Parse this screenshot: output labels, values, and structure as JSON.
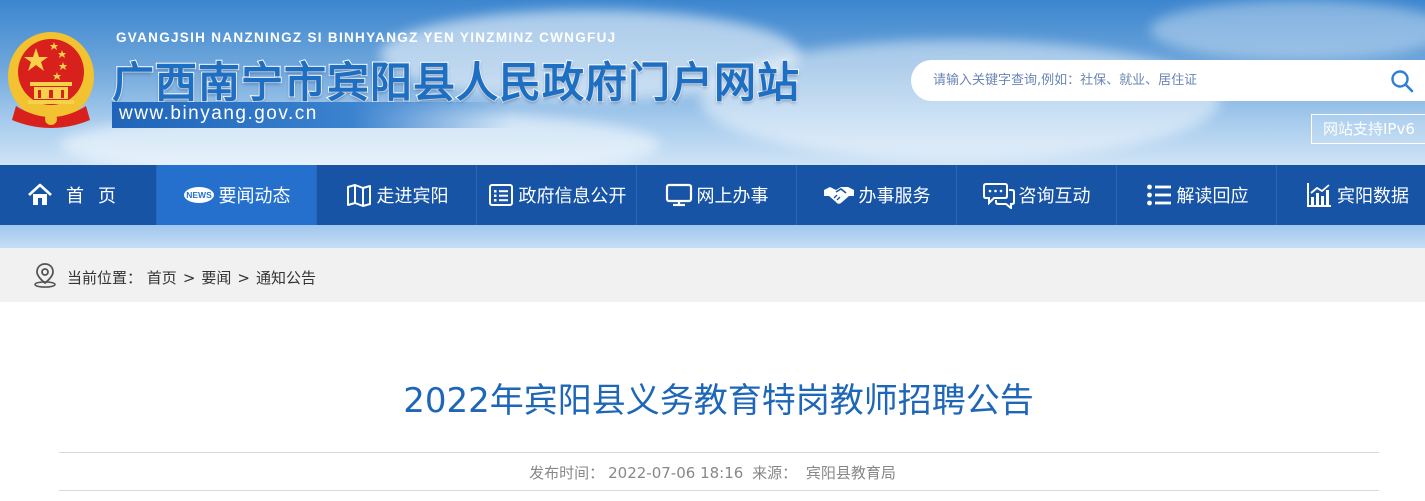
{
  "header": {
    "pinyin": "GVANGJSIH NANZNINGZ SI BINHYANGZ YEN YINZMINZ CWNGFUJ",
    "title": "广西南宁市宾阳县人民政府门户网站",
    "url": "www.binyang.gov.cn",
    "search_placeholder": "请输入关键字查询,例如：社保、就业、居住证",
    "ipv6_label": "网站支持IPv6"
  },
  "nav": {
    "items": [
      {
        "label": "首页",
        "icon": "home-icon"
      },
      {
        "label": "要闻动态",
        "icon": "news-icon",
        "icon_text": "NEWS"
      },
      {
        "label": "走进宾阳",
        "icon": "map-icon"
      },
      {
        "label": "政府信息公开",
        "icon": "list-document-icon"
      },
      {
        "label": "网上办事",
        "icon": "monitor-icon"
      },
      {
        "label": "办事服务",
        "icon": "handshake-icon"
      },
      {
        "label": "咨询互动",
        "icon": "chat-icon"
      },
      {
        "label": "解读回应",
        "icon": "bullet-list-icon"
      },
      {
        "label": "宾阳数据",
        "icon": "bar-chart-icon"
      }
    ],
    "active_index": 1
  },
  "breadcrumb": {
    "prefix": "当前位置：",
    "items": [
      "首页",
      "要闻",
      "通知公告"
    ],
    "separator": ">"
  },
  "article": {
    "title": "2022年宾阳县义务教育特岗教师招聘公告",
    "publish_label": "发布时间：",
    "publish_time": "2022-07-06 18:16",
    "source_label": "来源：",
    "source": "宾阳县教育局"
  },
  "colors": {
    "nav_bg": "#1854a6",
    "nav_active": "#2470cc",
    "title_blue": "#1e66b8",
    "emblem_red": "#d8201d",
    "emblem_gold": "#f2c230"
  }
}
